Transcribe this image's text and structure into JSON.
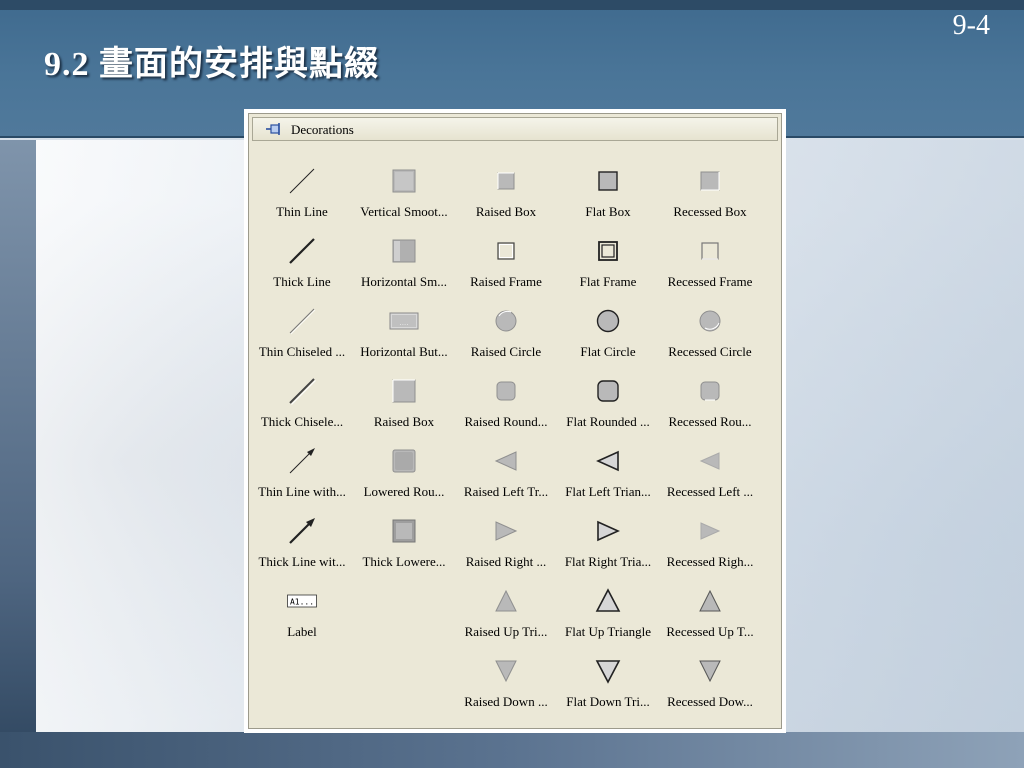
{
  "slide": {
    "title": "9.2 畫面的安排與點綴",
    "page_number": "9-4"
  },
  "palette": {
    "title": "Decorations",
    "title_icon": "pin-icon",
    "items": [
      {
        "label": "Thin Line",
        "icon": "thin-line-icon"
      },
      {
        "label": "Vertical Smoot...",
        "icon": "vertical-smooth-icon"
      },
      {
        "label": "Raised Box",
        "icon": "raised-box-icon"
      },
      {
        "label": "Flat Box",
        "icon": "flat-box-icon"
      },
      {
        "label": "Recessed Box",
        "icon": "recessed-box-icon"
      },
      {
        "label": "Thick Line",
        "icon": "thick-line-icon"
      },
      {
        "label": "Horizontal Sm...",
        "icon": "horizontal-smooth-icon"
      },
      {
        "label": "Raised Frame",
        "icon": "raised-frame-icon"
      },
      {
        "label": "Flat Frame",
        "icon": "flat-frame-icon"
      },
      {
        "label": "Recessed Frame",
        "icon": "recessed-frame-icon"
      },
      {
        "label": "Thin Chiseled ...",
        "icon": "thin-chiseled-line-icon"
      },
      {
        "label": "Horizontal But...",
        "icon": "horizontal-button-icon"
      },
      {
        "label": "Raised Circle",
        "icon": "raised-circle-icon"
      },
      {
        "label": "Flat Circle",
        "icon": "flat-circle-icon"
      },
      {
        "label": "Recessed Circle",
        "icon": "recessed-circle-icon"
      },
      {
        "label": "Thick Chisele...",
        "icon": "thick-chiseled-line-icon"
      },
      {
        "label": "Raised Box",
        "icon": "raised-box-large-icon"
      },
      {
        "label": "Raised Round...",
        "icon": "raised-rounded-box-icon"
      },
      {
        "label": "Flat Rounded ...",
        "icon": "flat-rounded-box-icon"
      },
      {
        "label": "Recessed Rou...",
        "icon": "recessed-rounded-box-icon"
      },
      {
        "label": "Thin Line with...",
        "icon": "thin-arrow-icon"
      },
      {
        "label": "Lowered Rou...",
        "icon": "lowered-rounded-box-icon"
      },
      {
        "label": "Raised Left Tr...",
        "icon": "raised-left-triangle-icon"
      },
      {
        "label": "Flat Left Trian...",
        "icon": "flat-left-triangle-icon"
      },
      {
        "label": "Recessed Left ...",
        "icon": "recessed-left-triangle-icon"
      },
      {
        "label": "Thick Line wit...",
        "icon": "thick-arrow-icon"
      },
      {
        "label": "Thick Lowere...",
        "icon": "thick-lowered-box-icon"
      },
      {
        "label": "Raised Right ...",
        "icon": "raised-right-triangle-icon"
      },
      {
        "label": "Flat Right Tria...",
        "icon": "flat-right-triangle-icon"
      },
      {
        "label": "Recessed Righ...",
        "icon": "recessed-right-triangle-icon"
      },
      {
        "label": "Label",
        "icon": "label-icon",
        "icon_text": "A1..."
      },
      null,
      {
        "label": "Raised Up Tri...",
        "icon": "raised-up-triangle-icon"
      },
      {
        "label": "Flat Up Triangle",
        "icon": "flat-up-triangle-icon"
      },
      {
        "label": "Recessed Up T...",
        "icon": "recessed-up-triangle-icon"
      },
      null,
      null,
      {
        "label": "Raised Down ...",
        "icon": "raised-down-triangle-icon"
      },
      {
        "label": "Flat Down Tri...",
        "icon": "flat-down-triangle-icon"
      },
      {
        "label": "Recessed Dow...",
        "icon": "recessed-down-triangle-icon"
      }
    ]
  }
}
